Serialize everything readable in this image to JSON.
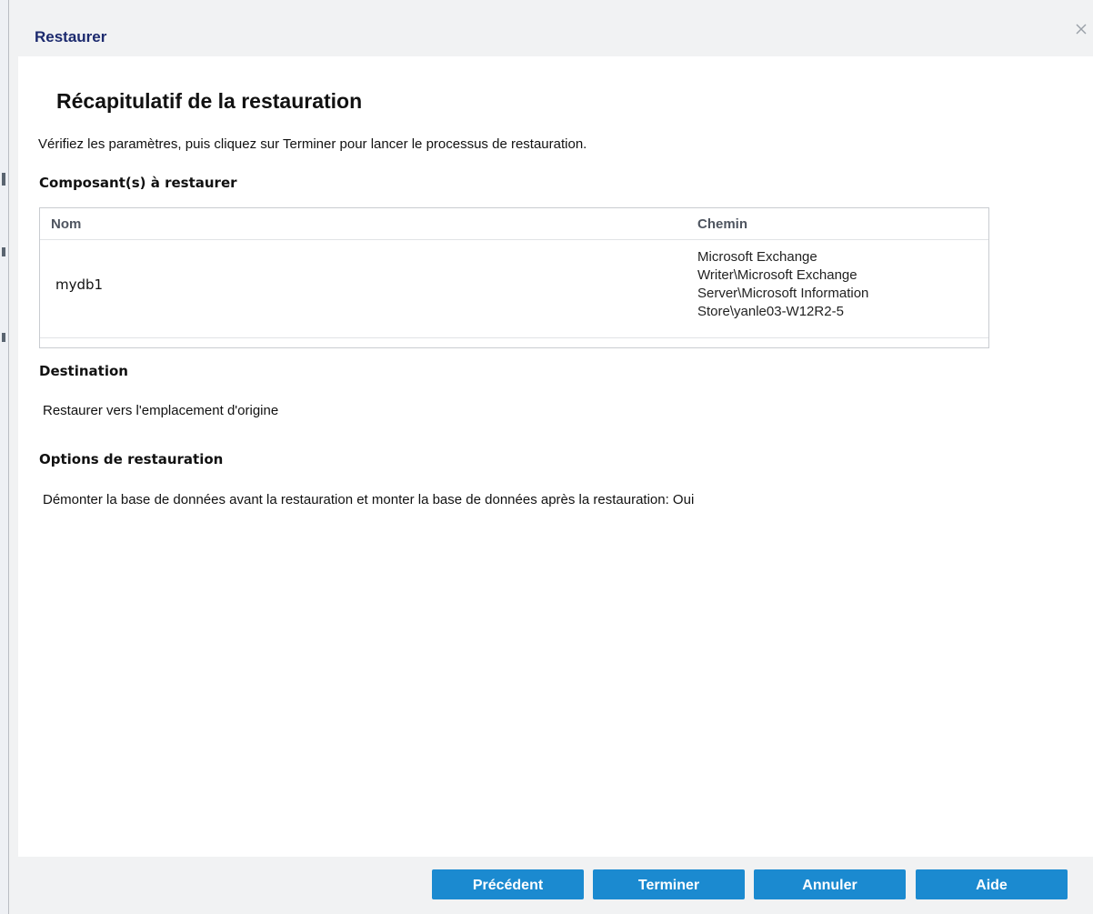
{
  "dialog": {
    "title": "Restaurer",
    "close_icon": "close-icon"
  },
  "summary": {
    "page_title": "Récapitulatif de la restauration",
    "intro": "Vérifiez les paramètres, puis cliquez sur Terminer pour lancer le processus de restauration."
  },
  "components": {
    "heading": "Composant(s) à restaurer",
    "columns": [
      "Nom",
      "Chemin"
    ],
    "rows": [
      {
        "name": "mydb1",
        "path_lines": [
          "Microsoft Exchange",
          "Writer\\Microsoft Exchange",
          "Server\\Microsoft Information",
          "Store\\yanle03-W12R2-5"
        ]
      }
    ]
  },
  "destination": {
    "heading": "Destination",
    "value": "Restaurer vers l'emplacement d'origine"
  },
  "options": {
    "heading": "Options de restauration",
    "value": "Démonter la base de données avant la restauration et monter la base de données après la restauration: Oui"
  },
  "buttons": {
    "previous": "Précédent",
    "finish": "Terminer",
    "cancel": "Annuler",
    "help": "Aide"
  },
  "colors": {
    "title": "#1c2a6e",
    "button": "#1b8ad0",
    "panel": "#f1f2f3"
  }
}
